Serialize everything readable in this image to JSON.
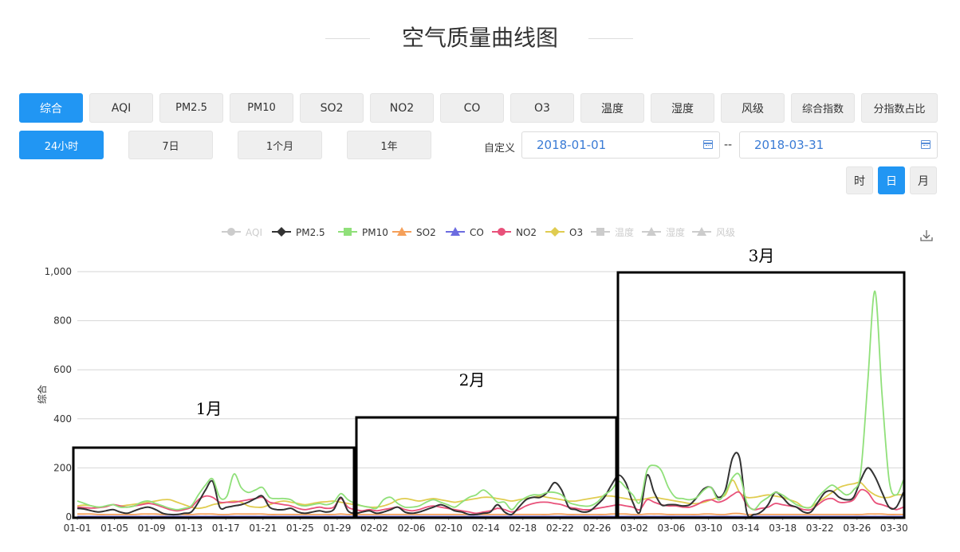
{
  "page": {
    "title": "空气质量曲线图"
  },
  "metric_tabs": [
    {
      "label": "综合",
      "active": true
    },
    {
      "label": "AQI",
      "active": false
    },
    {
      "label": "PM2.5",
      "active": false
    },
    {
      "label": "PM10",
      "active": false
    },
    {
      "label": "SO2",
      "active": false
    },
    {
      "label": "NO2",
      "active": false
    },
    {
      "label": "CO",
      "active": false
    },
    {
      "label": "O3",
      "active": false
    },
    {
      "label": "温度",
      "active": false
    },
    {
      "label": "湿度",
      "active": false
    },
    {
      "label": "风级",
      "active": false
    },
    {
      "label": "综合指数",
      "active": false
    },
    {
      "label": "分指数占比",
      "active": false
    }
  ],
  "range_tabs": [
    {
      "label": "24小时",
      "active": true
    },
    {
      "label": "7日",
      "active": false
    },
    {
      "label": "1个月",
      "active": false
    },
    {
      "label": "1年",
      "active": false
    }
  ],
  "custom_range": {
    "label": "自定义",
    "start": "2018-01-01",
    "separator": "--",
    "end": "2018-03-31"
  },
  "granularity_tabs": [
    {
      "label": "时",
      "active": false
    },
    {
      "label": "日",
      "active": true
    },
    {
      "label": "月",
      "active": false
    }
  ],
  "annotations": [
    "1月",
    "2月",
    "3月"
  ],
  "chart_data": {
    "type": "line",
    "ylabel": "综合",
    "ylim": [
      0,
      1000
    ],
    "y_ticks": [
      "0",
      "200",
      "400",
      "600",
      "800",
      "1,000"
    ],
    "x_ticks": [
      "01-01",
      "01-05",
      "01-09",
      "01-13",
      "01-17",
      "01-21",
      "01-25",
      "01-29",
      "02-02",
      "02-06",
      "02-10",
      "02-14",
      "02-18",
      "02-22",
      "02-26",
      "03-02",
      "03-06",
      "03-10",
      "03-14",
      "03-18",
      "03-22",
      "03-26",
      "03-30"
    ],
    "grid": true,
    "legend_position": "top-center",
    "x_start": "2018-01-01",
    "x_end": "2018-03-31",
    "series": [
      {
        "name": "AQI",
        "color": "#c8c8c8",
        "marker": "circle",
        "enabled": false,
        "values": []
      },
      {
        "name": "PM2.5",
        "color": "#333333",
        "marker": "diamond",
        "enabled": true,
        "values": [
          35,
          32,
          25,
          20,
          25,
          30,
          20,
          15,
          25,
          35,
          40,
          30,
          15,
          10,
          10,
          15,
          20,
          60,
          110,
          145,
          40,
          40,
          45,
          50,
          60,
          75,
          85,
          40,
          30,
          30,
          35,
          20,
          15,
          20,
          25,
          20,
          30,
          80,
          25,
          15,
          20,
          25,
          15,
          20,
          30,
          40,
          20,
          15,
          20,
          30,
          40,
          50,
          40,
          25,
          20,
          10,
          10,
          15,
          20,
          50,
          20,
          10,
          40,
          70,
          80,
          80,
          100,
          140,
          110,
          40,
          30,
          20,
          25,
          50,
          80,
          130,
          170,
          140,
          60,
          20,
          170,
          100,
          50,
          50,
          50,
          45,
          50,
          80,
          115,
          120,
          80,
          110,
          240,
          240,
          20,
          10,
          20,
          50,
          100,
          80,
          50,
          40,
          20,
          20,
          60,
          100,
          105,
          80,
          70,
          80,
          150,
          200,
          165,
          100,
          40,
          40,
          100
        ]
      },
      {
        "name": "PM10",
        "color": "#90e07a",
        "marker": "square",
        "enabled": true,
        "values": [
          65,
          55,
          45,
          40,
          45,
          50,
          40,
          40,
          45,
          60,
          65,
          55,
          45,
          35,
          30,
          35,
          45,
          90,
          130,
          155,
          80,
          85,
          175,
          120,
          100,
          110,
          120,
          80,
          75,
          75,
          70,
          50,
          45,
          50,
          55,
          50,
          60,
          95,
          70,
          55,
          45,
          40,
          35,
          70,
          80,
          55,
          40,
          40,
          45,
          60,
          70,
          60,
          50,
          40,
          60,
          80,
          90,
          110,
          90,
          60,
          60,
          30,
          60,
          80,
          90,
          90,
          100,
          100,
          90,
          60,
          50,
          45,
          45,
          60,
          90,
          110,
          145,
          120,
          90,
          60,
          190,
          210,
          190,
          120,
          80,
          75,
          70,
          80,
          110,
          120,
          70,
          100,
          160,
          170,
          60,
          30,
          60,
          80,
          100,
          90,
          70,
          50,
          40,
          40,
          80,
          110,
          130,
          110,
          90,
          110,
          180,
          550,
          920,
          500,
          150,
          90,
          150
        ]
      },
      {
        "name": "SO2",
        "color": "#f5a05a",
        "marker": "triangle",
        "enabled": true,
        "values": [
          12,
          12,
          12,
          10,
          10,
          10,
          10,
          10,
          10,
          12,
          12,
          12,
          10,
          10,
          10,
          10,
          10,
          12,
          12,
          12,
          10,
          10,
          12,
          12,
          12,
          12,
          12,
          10,
          10,
          10,
          10,
          10,
          10,
          10,
          10,
          10,
          10,
          12,
          10,
          10,
          10,
          10,
          10,
          10,
          10,
          10,
          10,
          10,
          10,
          10,
          10,
          10,
          10,
          10,
          10,
          10,
          10,
          10,
          10,
          10,
          10,
          10,
          10,
          10,
          10,
          10,
          10,
          12,
          12,
          10,
          10,
          10,
          10,
          10,
          10,
          12,
          12,
          12,
          10,
          10,
          12,
          12,
          12,
          10,
          10,
          10,
          10,
          10,
          12,
          12,
          10,
          10,
          14,
          14,
          10,
          10,
          10,
          10,
          10,
          10,
          10,
          10,
          10,
          10,
          10,
          10,
          10,
          10,
          10,
          10,
          10,
          12,
          12,
          12,
          10,
          10,
          10
        ]
      },
      {
        "name": "CO",
        "color": "#6c6ce0",
        "marker": "triangle",
        "enabled": true,
        "values": [
          2,
          2,
          2,
          2,
          2,
          2,
          2,
          2,
          2,
          2,
          2,
          2,
          2,
          2,
          2,
          2,
          2,
          2,
          2,
          2,
          2,
          2,
          2,
          2,
          2,
          2,
          2,
          2,
          2,
          2,
          2,
          2,
          2,
          2,
          2,
          2,
          2,
          2,
          2,
          2,
          2,
          2,
          2,
          2,
          2,
          2,
          2,
          2,
          2,
          2,
          2,
          2,
          2,
          2,
          2,
          2,
          2,
          2,
          2,
          2,
          2,
          2,
          2,
          2,
          2,
          2,
          2,
          2,
          2,
          2,
          2,
          2,
          2,
          2,
          2,
          2,
          2,
          2,
          2,
          2,
          2,
          2,
          2,
          2,
          2,
          2,
          2,
          2,
          2,
          2,
          2,
          2,
          2,
          2,
          2,
          2,
          2,
          2,
          2,
          2,
          2,
          2,
          2,
          2,
          2,
          2,
          2,
          2,
          2,
          2,
          2,
          2,
          2,
          2,
          2,
          2,
          2
        ]
      },
      {
        "name": "NO2",
        "color": "#e8517a",
        "marker": "circle",
        "enabled": true,
        "values": [
          40,
          38,
          36,
          38,
          42,
          50,
          45,
          40,
          45,
          50,
          55,
          50,
          40,
          30,
          25,
          30,
          40,
          70,
          85,
          80,
          60,
          60,
          60,
          65,
          70,
          75,
          80,
          60,
          55,
          50,
          45,
          35,
          30,
          35,
          40,
          35,
          40,
          75,
          40,
          30,
          25,
          30,
          25,
          30,
          35,
          40,
          30,
          25,
          30,
          40,
          45,
          40,
          35,
          30,
          25,
          20,
          15,
          20,
          25,
          35,
          30,
          20,
          30,
          45,
          55,
          60,
          60,
          55,
          50,
          40,
          35,
          30,
          30,
          35,
          40,
          45,
          50,
          45,
          40,
          30,
          70,
          60,
          50,
          45,
          45,
          40,
          40,
          50,
          65,
          70,
          60,
          70,
          90,
          100,
          50,
          30,
          35,
          40,
          55,
          50,
          45,
          40,
          30,
          30,
          50,
          70,
          75,
          60,
          60,
          70,
          110,
          100,
          60,
          50,
          40,
          30,
          40
        ]
      },
      {
        "name": "O3",
        "color": "#e0cc50",
        "marker": "diamond",
        "enabled": true,
        "values": [
          45,
          48,
          45,
          40,
          42,
          50,
          45,
          48,
          52,
          55,
          60,
          65,
          70,
          70,
          60,
          50,
          40,
          35,
          40,
          50,
          55,
          60,
          65,
          60,
          45,
          40,
          40,
          50,
          60,
          65,
          60,
          55,
          50,
          55,
          60,
          62,
          65,
          60,
          55,
          50,
          45,
          40,
          40,
          45,
          55,
          70,
          75,
          70,
          65,
          70,
          75,
          70,
          65,
          60,
          65,
          70,
          75,
          80,
          80,
          75,
          70,
          65,
          70,
          75,
          80,
          85,
          80,
          75,
          70,
          65,
          65,
          70,
          75,
          80,
          85,
          85,
          80,
          75,
          70,
          70,
          75,
          80,
          75,
          70,
          65,
          60,
          55,
          55,
          60,
          70,
          80,
          90,
          150,
          100,
          80,
          80,
          85,
          90,
          85,
          80,
          70,
          60,
          40,
          40,
          60,
          80,
          100,
          120,
          130,
          135,
          140,
          110,
          90,
          80,
          80,
          90,
          90
        ]
      },
      {
        "name": "温度",
        "color": "#c8c8c8",
        "marker": "square",
        "enabled": false,
        "values": []
      },
      {
        "name": "湿度",
        "color": "#c8c8c8",
        "marker": "triangle",
        "enabled": false,
        "values": []
      },
      {
        "name": "风级",
        "color": "#c8c8c8",
        "marker": "triangle",
        "enabled": false,
        "values": []
      }
    ]
  },
  "icons": {
    "download": "download-icon",
    "calendar": "calendar-icon"
  }
}
